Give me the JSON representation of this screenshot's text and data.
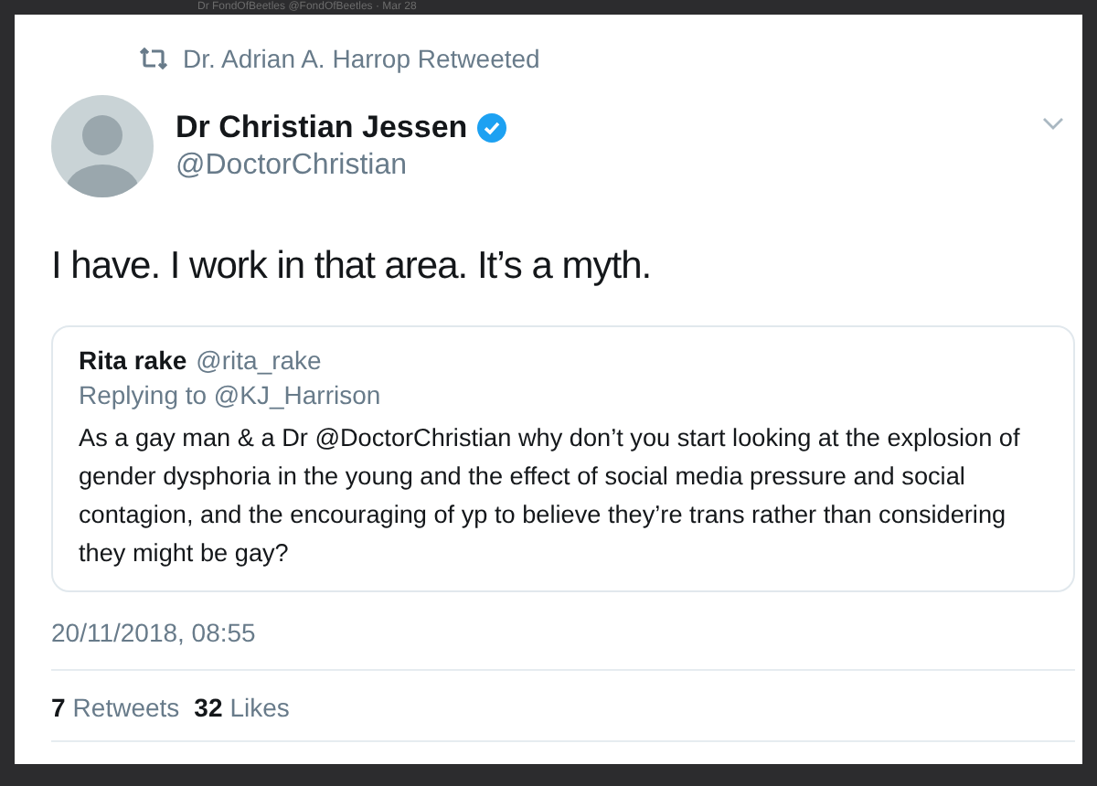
{
  "previous_tweet_header": "Dr FondOfBeetles @FondOfBeetles · Mar 28",
  "retweet_context": "Dr. Adrian A. Harrop Retweeted",
  "author": {
    "name": "Dr Christian Jessen",
    "verified": true,
    "handle": "@DoctorChristian"
  },
  "text": "I have. I work in that area. It’s a myth.",
  "quoted_tweet": {
    "name": "Rita rake",
    "handle": "@rita_rake",
    "replying_to": "Replying to @KJ_Harrison",
    "text": "As a gay man & a Dr @DoctorChristian why don’t you start looking at the explosion of gender dysphoria in the young and the effect of social media pressure and social contagion, and the encouraging of yp to believe they’re trans rather than considering they might be gay?"
  },
  "timestamp": "20/11/2018, 08:55",
  "stats": [
    {
      "count": "7",
      "label": "Retweets"
    },
    {
      "count": "32",
      "label": "Likes"
    }
  ]
}
